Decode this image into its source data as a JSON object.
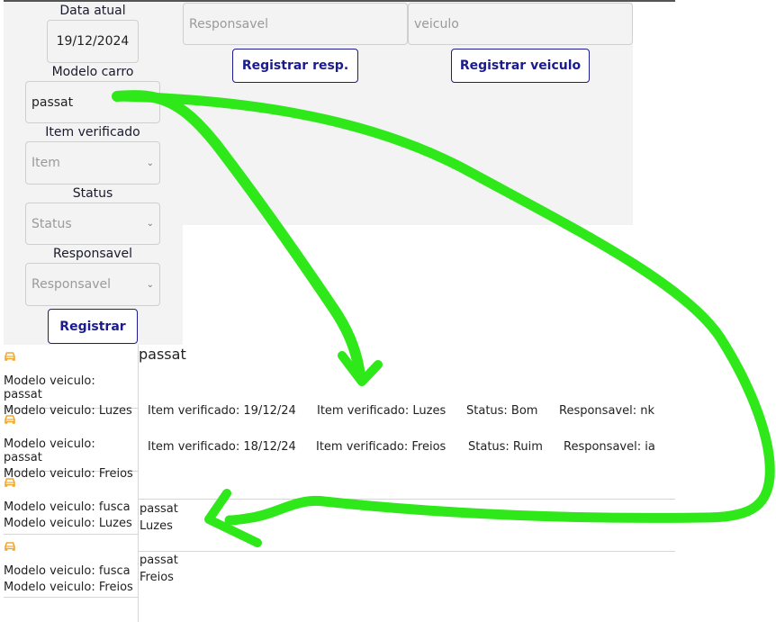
{
  "form": {
    "date_label": "Data atual",
    "date_value": "19/12/2024",
    "model_label": "Modelo carro",
    "model_value": "passat",
    "item_label": "Item verificado",
    "item_placeholder": "Item",
    "status_label": "Status",
    "status_placeholder": "Status",
    "resp_label": "Responsavel",
    "resp_placeholder": "Responsavel",
    "register_button": "Registrar"
  },
  "top_inputs": {
    "responsavel_placeholder": "Responsavel",
    "veiculo_placeholder": "veiculo",
    "register_resp_button": "Registrar resp.",
    "register_vehicle_button": "Registrar veiculo"
  },
  "left_list": {
    "items": [
      {
        "icon": "car-icon",
        "line1": "Modelo veiculo: passat",
        "line2": "Modelo veiculo: Luzes"
      },
      {
        "icon": "car-icon",
        "line1": "Modelo veiculo: passat",
        "line2": "Modelo veiculo: Freios"
      },
      {
        "icon": "car-icon",
        "line1": "Modelo veiculo: fusca",
        "line2": "Modelo veiculo: Luzes"
      },
      {
        "icon": "car-icon",
        "line1": "Modelo veiculo: fusca",
        "line2": "Modelo veiculo: Freios"
      }
    ]
  },
  "detail": {
    "title": "passat",
    "rows": [
      {
        "date": "Item verificado: 19/12/24",
        "item": "Item verificado: Luzes",
        "status": "Status: Bom",
        "resp": "Responsavel: nk"
      },
      {
        "date": "Item verificado: 18/12/24",
        "item": "Item verificado: Freios",
        "status": "Status: Ruim",
        "resp": "Responsavel: ia"
      }
    ]
  },
  "entries": [
    {
      "model": "passat",
      "item": "Luzes"
    },
    {
      "model": "passat",
      "item": "Freios"
    }
  ],
  "colors": {
    "accent": "#1b1b8f",
    "icon": "#f0a830",
    "annotation": "#2ee81a",
    "panel": "#f3f3f3"
  }
}
